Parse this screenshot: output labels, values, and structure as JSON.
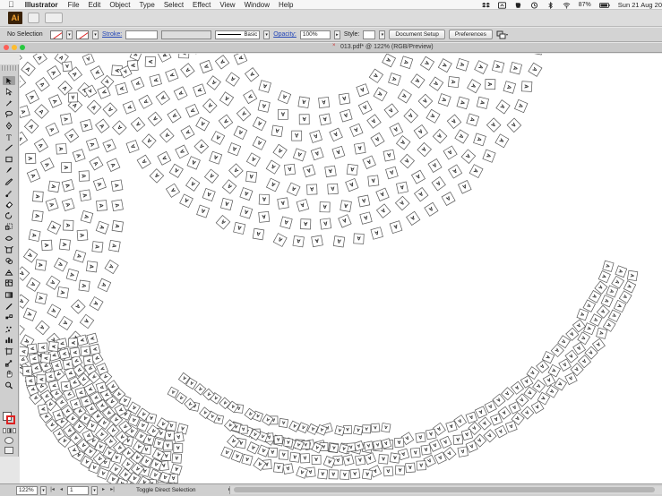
{
  "menubar": {
    "app_name": "Illustrator",
    "menus": [
      "File",
      "Edit",
      "Object",
      "Type",
      "Select",
      "Effect",
      "View",
      "Window",
      "Help"
    ],
    "battery": "87%",
    "clock": "Sun 21 Aug 20"
  },
  "appbar": {
    "logo_text": "Ai"
  },
  "controlbar": {
    "selection_status": "No Selection",
    "stroke_label": "Stroke:",
    "brush_label": "Basic",
    "opacity_label": "Opacity:",
    "opacity_value": "100%",
    "style_label": "Style:",
    "document_setup_label": "Document Setup",
    "preferences_label": "Preferences"
  },
  "tabbar": {
    "close_glyph": "×",
    "document_title": "013.pdf* @ 122% (RGB/Preview)"
  },
  "canvas": {
    "glyph_char": "A"
  },
  "statusbar": {
    "zoom_value": "122%",
    "artboard_value": "1",
    "status_text": "Toggle Direct Selection"
  },
  "colors": {
    "accent_link": "#2447b8",
    "ai_logo_bg": "#3a2208",
    "ai_logo_fg": "#f3a232",
    "traffic_red": "#fe5f57",
    "traffic_yellow": "#febc2e",
    "traffic_green": "#28c840"
  },
  "icons": {
    "tools": [
      "selection-tool",
      "direct-selection-tool",
      "magic-wand-tool",
      "lasso-tool",
      "pen-tool",
      "type-tool",
      "line-tool",
      "rectangle-tool",
      "paintbrush-tool",
      "pencil-tool",
      "blob-brush-tool",
      "eraser-tool",
      "rotate-tool",
      "scale-tool",
      "width-tool",
      "free-transform-tool",
      "shape-builder-tool",
      "perspective-grid-tool",
      "mesh-tool",
      "gradient-tool",
      "eyedropper-tool",
      "blend-tool",
      "symbol-sprayer-tool",
      "column-graph-tool",
      "artboard-tool",
      "slice-tool",
      "hand-tool",
      "zoom-tool"
    ]
  }
}
